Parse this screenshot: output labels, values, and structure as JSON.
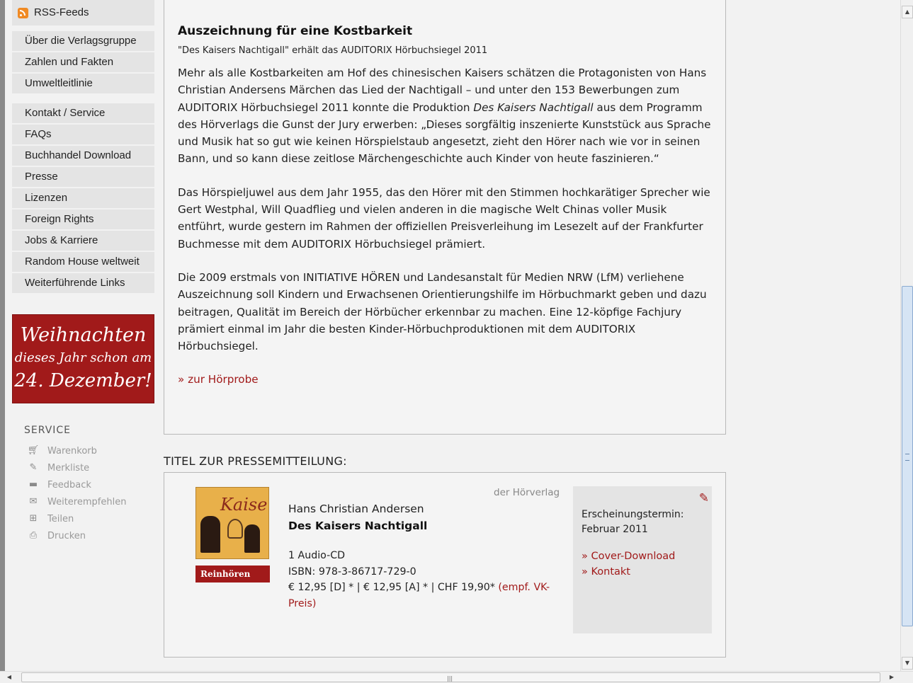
{
  "sidebar": {
    "rss_label": "RSS-Feeds",
    "group1": [
      "Über die Verlagsgruppe",
      "Zahlen und Fakten",
      "Umweltleitlinie"
    ],
    "group2": [
      "Kontakt / Service",
      "FAQs",
      "Buchhandel Download",
      "Presse",
      "Lizenzen",
      "Foreign Rights",
      "Jobs & Karriere",
      "Random House weltweit",
      "Weiterführende Links"
    ],
    "promo": {
      "line1": "Weihnachten",
      "line2": "dieses Jahr schon am",
      "line3": "24. Dezember!"
    },
    "service": {
      "title": "SERVICE",
      "items": [
        {
          "label": "Warenkorb",
          "icon": "cart-icon"
        },
        {
          "label": "Merkliste",
          "icon": "notepad-icon"
        },
        {
          "label": "Feedback",
          "icon": "speech-bubble-icon"
        },
        {
          "label": "Weiterempfehlen",
          "icon": "envelope-icon"
        },
        {
          "label": "Teilen",
          "icon": "plus-icon"
        },
        {
          "label": "Drucken",
          "icon": "printer-icon"
        }
      ]
    }
  },
  "article": {
    "title": "Auszeichnung für eine Kostbarkeit",
    "subtitle": "\"Des Kaisers Nachtigall\" erhält das AUDITORIX Hörbuchsiegel 2011",
    "p1_a": "Mehr als alle Kostbarkeiten am Hof des chinesischen Kaisers schätzen die Protagonisten von Hans Christian Andersens Märchen das Lied der Nachtigall – und unter den 153 Bewerbungen zum AUDITORIX Hörbuchsiegel 2011 konnte die Produktion ",
    "p1_em": "Des Kaisers Nachtigall",
    "p1_b": " aus dem Programm des Hörverlags die Gunst der Jury erwerben: „Dieses sorgfältig inszenierte Kunststück aus Sprache und Musik hat so gut wie keinen Hörspielstaub angesetzt, zieht den Hörer nach wie vor in seinen Bann, und so kann diese zeitlose Märchengeschichte auch Kinder von heute faszinieren.“",
    "p2": "Das Hörspieljuwel aus dem Jahr 1955, das den Hörer mit den Stimmen hochkarätiger Sprecher wie Gert Westphal, Will Quadflieg und vielen anderen in die magische Welt Chinas voller Musik entführt, wurde gestern im Rahmen der offiziellen Preisverleihung im Lesezelt auf der Frankfurter Buchmesse mit dem AUDITORIX Hörbuchsiegel prämiert.",
    "p3": "Die 2009 erstmals von INITIATIVE HÖREN und Landesanstalt für Medien NRW (LfM) verliehene Auszeichnung soll Kindern und Erwachsenen Orientierungshilfe im Hörbuchmarkt geben und dazu beitragen, Qualität im Bereich der Hörbücher erkennbar zu machen. Eine 12-köpfige Fachjury prämiert einmal im Jahr die besten Kinder-Hörbuchproduktionen mit dem AUDITORIX Hörbuchsiegel.",
    "link": "» zur Hörprobe"
  },
  "titles": {
    "heading": "TITEL ZUR PRESSEMITTEILUNG:",
    "cover_text": "Kaisers",
    "listen_button": "Reinhören",
    "publisher": "der Hörverlag",
    "author": "Hans Christian Andersen",
    "title": "Des Kaisers Nachtigall",
    "format": "1 Audio-CD",
    "isbn": "ISBN: 978-3-86717-729-0",
    "price": "€ 12,95 [D] * | € 12,95 [A] * | CHF 19,90* ",
    "price_note": "(empf. VK-Preis)",
    "release_label": "Erscheinungstermin:",
    "release_date": "Februar 2011",
    "cover_download": "» Cover-Download",
    "contact": "» Kontakt"
  },
  "colors": {
    "accent": "#a11a1a",
    "nav_bg": "#e4e4e4",
    "page_bg": "#f2f2f2"
  }
}
